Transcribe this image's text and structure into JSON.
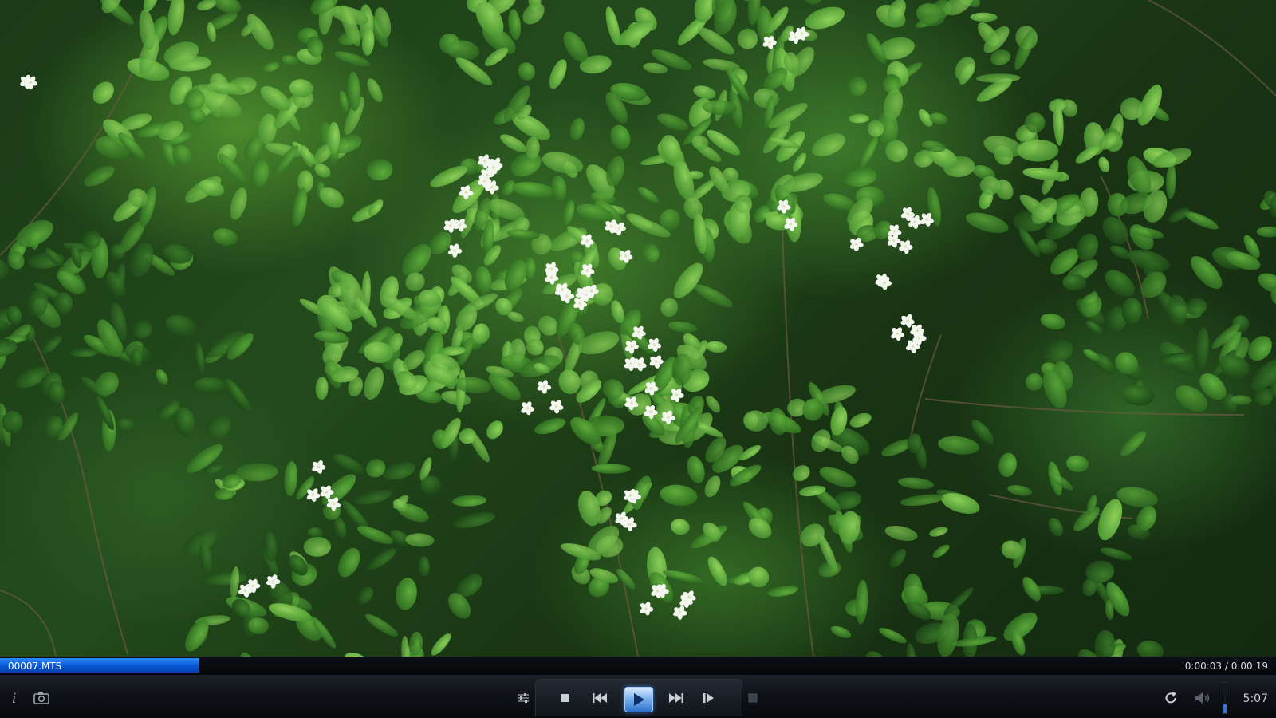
{
  "player": {
    "file_name": "00007.MTS",
    "time_readout": "0:00:03 / 0:00:19",
    "playback_progress": 0.155,
    "clock": "5:07",
    "volume_level": 0.3,
    "accent_color": "#0a56d6"
  },
  "controls": {
    "left": [
      {
        "id": "info",
        "icon": "info-icon"
      },
      {
        "id": "snapshot",
        "icon": "camera-icon"
      }
    ],
    "center": [
      {
        "id": "settings",
        "icon": "sliders-icon"
      },
      {
        "id": "stop",
        "icon": "stop-icon"
      },
      {
        "id": "previous",
        "icon": "skip-back-icon"
      },
      {
        "id": "play",
        "icon": "play-icon"
      },
      {
        "id": "next",
        "icon": "skip-forward-icon"
      },
      {
        "id": "step",
        "icon": "frame-step-icon"
      },
      {
        "id": "fullscreen",
        "icon": "square-icon"
      }
    ],
    "right": [
      {
        "id": "repeat",
        "icon": "repeat-icon"
      },
      {
        "id": "volume",
        "icon": "speaker-icon"
      }
    ]
  }
}
